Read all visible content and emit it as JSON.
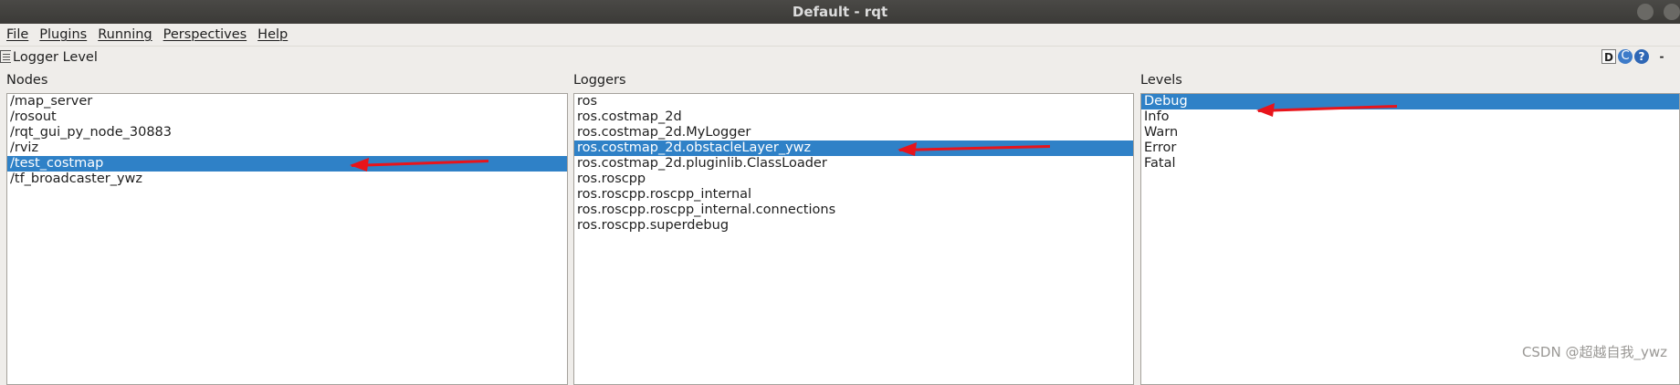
{
  "window": {
    "title": "Default - rqt"
  },
  "menu": [
    {
      "label": "File",
      "name": "menu-file"
    },
    {
      "label": "Plugins",
      "name": "menu-plugins"
    },
    {
      "label": "Running",
      "name": "menu-running"
    },
    {
      "label": "Perspectives",
      "name": "menu-perspectives"
    },
    {
      "label": "Help",
      "name": "menu-help"
    }
  ],
  "plugin": {
    "title": "Logger Level",
    "icon": "list-icon",
    "buttons": {
      "d": "D",
      "reload": "C",
      "help": "?",
      "minimize": "-"
    }
  },
  "columns": {
    "nodes": {
      "label": "Nodes",
      "items": [
        "/map_server",
        "/rosout",
        "/rqt_gui_py_node_30883",
        "/rviz",
        "/test_costmap",
        "/tf_broadcaster_ywz"
      ],
      "selected": 4
    },
    "loggers": {
      "label": "Loggers",
      "items": [
        "ros",
        "ros.costmap_2d",
        "ros.costmap_2d.MyLogger",
        "ros.costmap_2d.obstacleLayer_ywz",
        "ros.costmap_2d.pluginlib.ClassLoader",
        "ros.roscpp",
        "ros.roscpp.roscpp_internal",
        "ros.roscpp.roscpp_internal.connections",
        "ros.roscpp.superdebug"
      ],
      "selected": 3
    },
    "levels": {
      "label": "Levels",
      "items": [
        "Debug",
        "Info",
        "Warn",
        "Error",
        "Fatal"
      ],
      "selected": 0
    }
  },
  "annotation_color": "#e8141b",
  "watermark": "CSDN @超越自我_ywz"
}
